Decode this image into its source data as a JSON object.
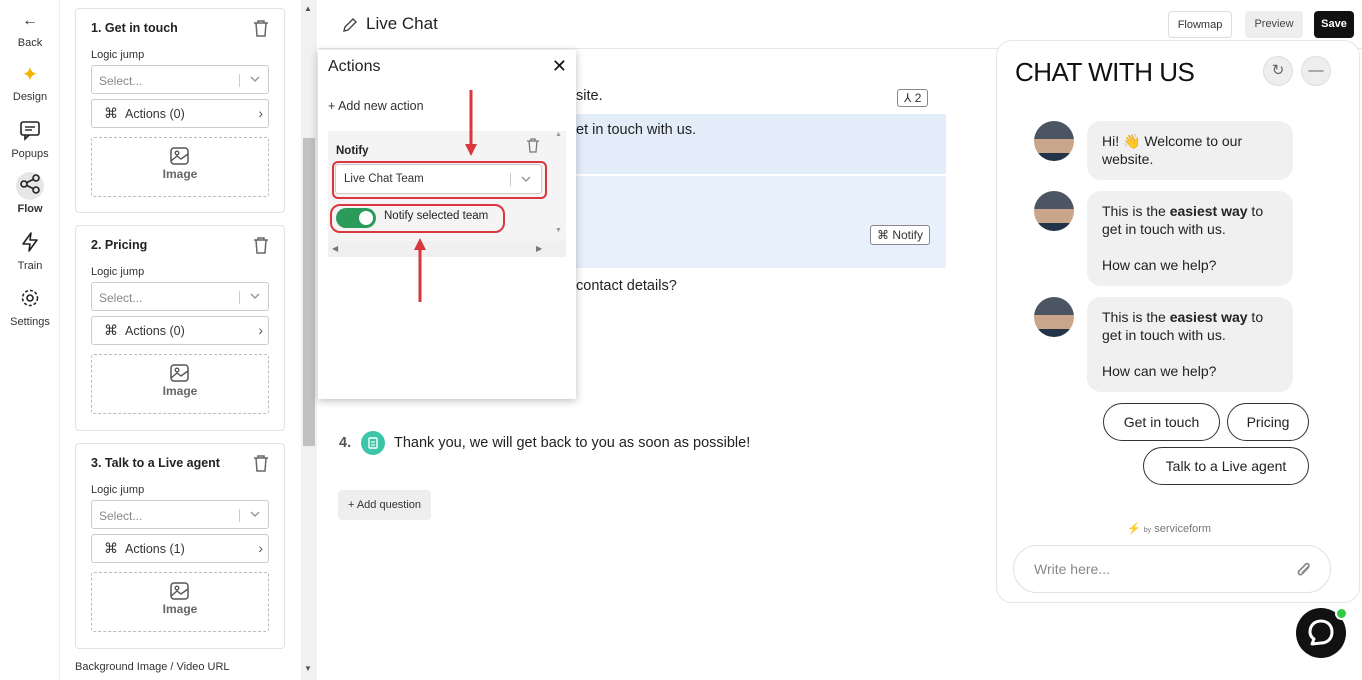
{
  "nav": {
    "back": "Back",
    "items": [
      {
        "label": "Design",
        "icon": "sparkle-icon"
      },
      {
        "label": "Popups",
        "icon": "chat-bubble-icon"
      },
      {
        "label": "Flow",
        "icon": "share-nodes-icon",
        "active": true
      },
      {
        "label": "Train",
        "icon": "lightning-icon"
      },
      {
        "label": "Settings",
        "icon": "gear-icon"
      }
    ]
  },
  "sidebar": {
    "cards": [
      {
        "title": "1. Get in touch",
        "logic_label": "Logic jump",
        "select_placeholder": "Select...",
        "actions_label": "Actions (0)",
        "image_label": "Image"
      },
      {
        "title": "2. Pricing",
        "logic_label": "Logic jump",
        "select_placeholder": "Select...",
        "actions_label": "Actions (0)",
        "image_label": "Image"
      },
      {
        "title": "3. Talk to a Live agent",
        "logic_label": "Logic jump",
        "select_placeholder": "Select...",
        "actions_label": "Actions (1)",
        "image_label": "Image"
      }
    ],
    "bg_label": "Background Image / Video URL"
  },
  "header": {
    "title": "Live Chat",
    "flowmap": "Flowmap",
    "preview": "Preview",
    "save": "Save"
  },
  "main": {
    "q1_tail": "site.",
    "q1_badge": "2",
    "q2_tail": "et in touch with us.",
    "notify_tag": "Notify",
    "q3_tail": "contact details?",
    "q4_number": "4.",
    "q4_text": "Thank you, we will get back to you as soon as possible!",
    "add_question": "+ Add question"
  },
  "actions_popup": {
    "title": "Actions",
    "add_action": "+ Add new action",
    "notify_title": "Notify",
    "team_value": "Live Chat Team",
    "toggle_label": "Notify selected team",
    "toggle_on": true
  },
  "chat": {
    "title": "CHAT WITH US",
    "messages": [
      {
        "text": "Hi! 👋 Welcome to our website."
      },
      {
        "pre": "This is the ",
        "bold": "easiest way",
        "post": " to get in touch with us.",
        "line2": "How can we help?"
      },
      {
        "pre": "This is the ",
        "bold": "easiest way",
        "post": " to get in touch with us.",
        "line2": "How can we help?"
      }
    ],
    "choices": [
      "Get in touch",
      "Pricing",
      "Talk to a Live agent"
    ],
    "powered_by": "by",
    "brand": "serviceform",
    "input_placeholder": "Write here..."
  },
  "colors": {
    "accent_red": "#d9363e",
    "toggle_green": "#2a9b5b",
    "highlight_blue": "#e3edfa",
    "online_green": "#2ecc40"
  }
}
